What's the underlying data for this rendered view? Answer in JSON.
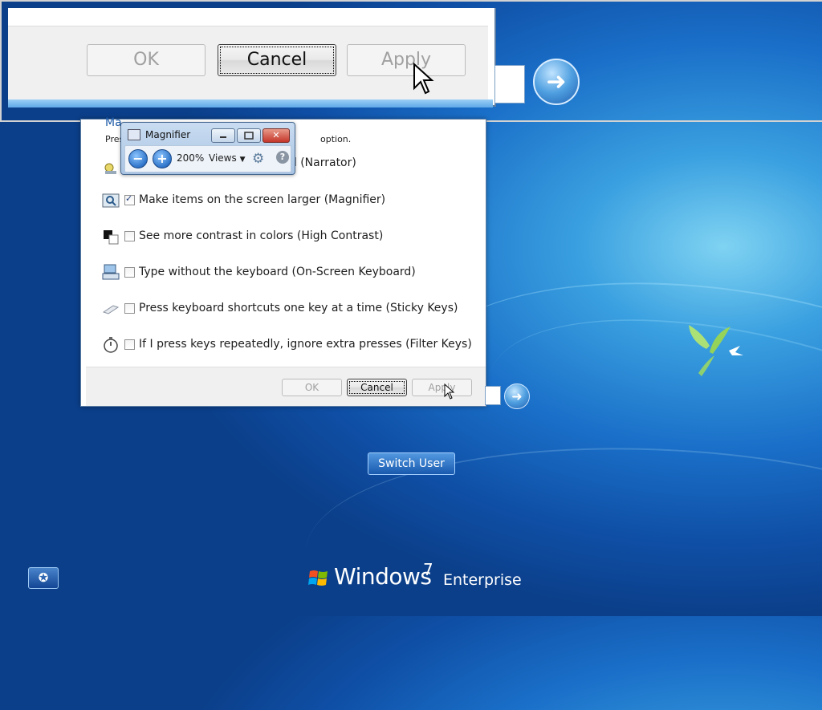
{
  "zoomed_view": {
    "ok_label": "OK",
    "cancel_label": "Cancel",
    "apply_label": "Apply"
  },
  "ease_dialog": {
    "heading_fragment": "Ma",
    "instruction_fragment": "Pres",
    "instruction_tail": "option.",
    "narrator_label_fragment": "ud (Narrator)",
    "options": [
      {
        "label": "Make items on the screen larger (Magnifier)",
        "checked": true,
        "icon": "magnifier-icon"
      },
      {
        "label": "See more contrast in colors (High Contrast)",
        "checked": false,
        "icon": "high-contrast-icon"
      },
      {
        "label": "Type without the keyboard (On-Screen Keyboard)",
        "checked": false,
        "icon": "keyboard-icon"
      },
      {
        "label": "Press keyboard shortcuts one key at a time (Sticky Keys)",
        "checked": false,
        "icon": "sticky-keys-icon"
      },
      {
        "label": "If I press keys repeatedly, ignore extra presses (Filter Keys)",
        "checked": false,
        "icon": "stopwatch-icon"
      }
    ],
    "ok_label": "OK",
    "cancel_label": "Cancel",
    "apply_label": "Apply"
  },
  "magnifier": {
    "title": "Magnifier",
    "zoom_level": "200%",
    "views_label": "Views",
    "close_glyph": "✕",
    "minus_glyph": "−",
    "plus_glyph": "+",
    "help_glyph": "?"
  },
  "login": {
    "switch_user_label": "Switch User"
  },
  "branding": {
    "name": "Windows",
    "version": "7",
    "edition": "Enterprise"
  },
  "colors": {
    "dialog_link_blue": "#1e5aa8",
    "desktop_blue": "#1a6fc8"
  }
}
